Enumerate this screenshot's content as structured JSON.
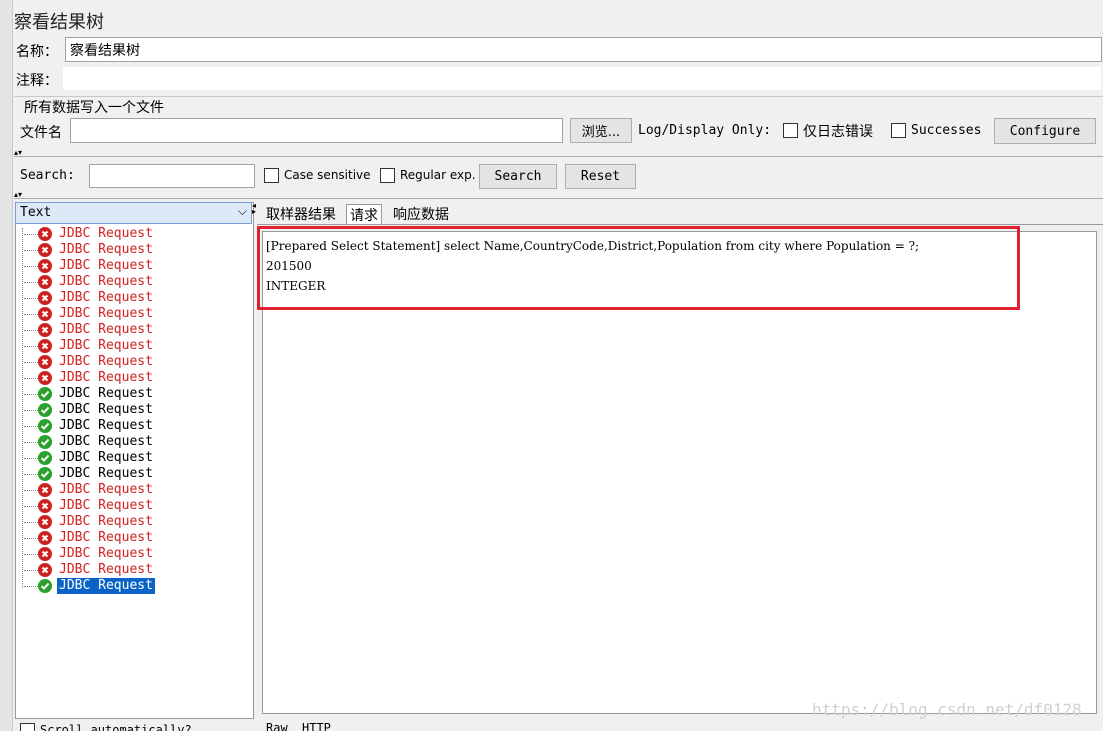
{
  "title": "察看结果树",
  "name_label": "名称：",
  "name_value": "察看结果树",
  "comment_label": "注释：",
  "file_section_title": "所有数据写入一个文件",
  "file_label": "文件名",
  "browse_label": "浏览...",
  "log_display_label": "Log/Display Only:",
  "errors_only_label": "仅日志错误",
  "successes_label": "Successes",
  "configure_label": "Configure",
  "search_label": "Search:",
  "case_sensitive_label": "Case sensitive",
  "regular_exp_label": "Regular exp.",
  "search_button_label": "Search",
  "reset_button_label": "Reset",
  "renderer_select": "Text",
  "tabs": [
    "取样器结果",
    "请求",
    "响应数据"
  ],
  "request_lines": [
    "[Prepared Select Statement] select Name,CountryCode,District,Population from city where Population = ?;",
    "201500",
    "INTEGER"
  ],
  "bottom_tabs": [
    "Raw",
    "HTTP"
  ],
  "scroll_auto_label": "Scroll automatically?",
  "watermark": "https://blog.csdn.net/df0128",
  "colors": {
    "error": "#d42020",
    "success_icon": "#2aa12a",
    "error_icon": "#cc2222",
    "selected": "#0a64c8",
    "highlight_box": "#e02030"
  },
  "samples": [
    {
      "label": "JDBC Request",
      "status": "error"
    },
    {
      "label": "JDBC Request",
      "status": "error"
    },
    {
      "label": "JDBC Request",
      "status": "error"
    },
    {
      "label": "JDBC Request",
      "status": "error"
    },
    {
      "label": "JDBC Request",
      "status": "error"
    },
    {
      "label": "JDBC Request",
      "status": "error"
    },
    {
      "label": "JDBC Request",
      "status": "error"
    },
    {
      "label": "JDBC Request",
      "status": "error"
    },
    {
      "label": "JDBC Request",
      "status": "error"
    },
    {
      "label": "JDBC Request",
      "status": "error"
    },
    {
      "label": "JDBC Request",
      "status": "success"
    },
    {
      "label": "JDBC Request",
      "status": "success"
    },
    {
      "label": "JDBC Request",
      "status": "success"
    },
    {
      "label": "JDBC Request",
      "status": "success"
    },
    {
      "label": "JDBC Request",
      "status": "success"
    },
    {
      "label": "JDBC Request",
      "status": "success"
    },
    {
      "label": "JDBC Request",
      "status": "error"
    },
    {
      "label": "JDBC Request",
      "status": "error"
    },
    {
      "label": "JDBC Request",
      "status": "error"
    },
    {
      "label": "JDBC Request",
      "status": "error"
    },
    {
      "label": "JDBC Request",
      "status": "error"
    },
    {
      "label": "JDBC Request",
      "status": "error"
    },
    {
      "label": "JDBC Request",
      "status": "success",
      "selected": true
    }
  ]
}
